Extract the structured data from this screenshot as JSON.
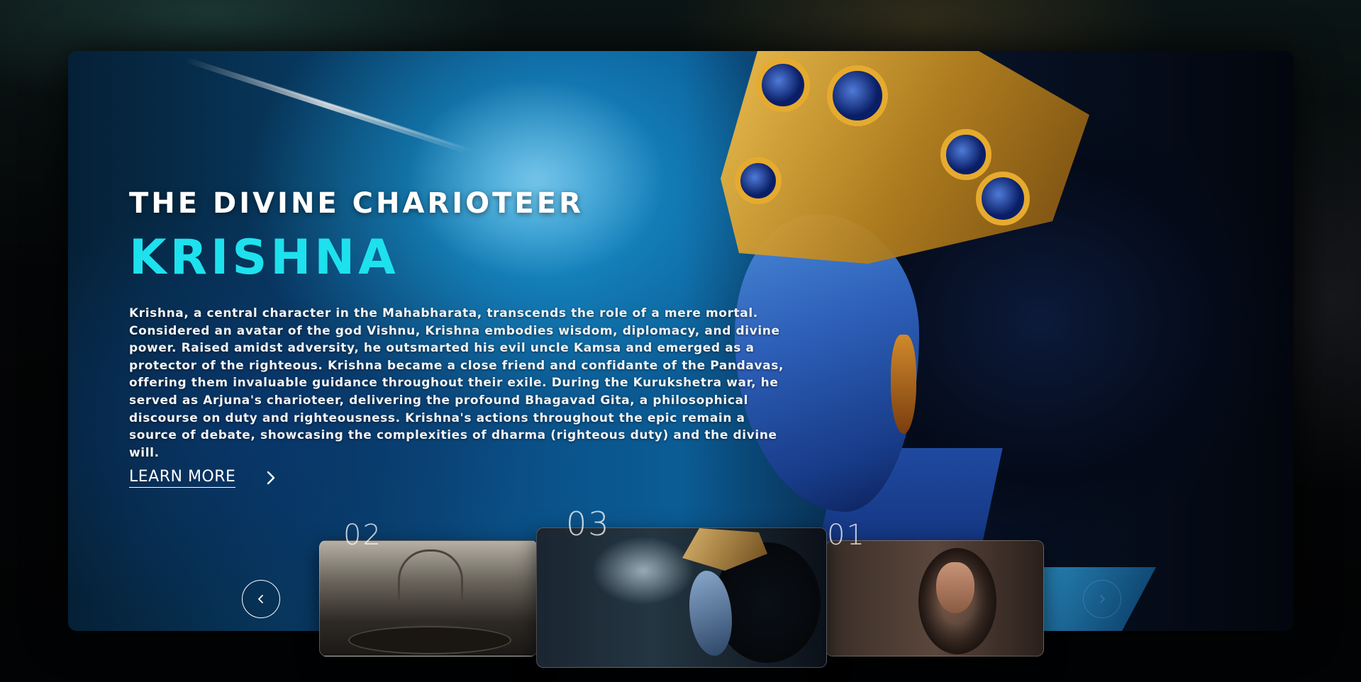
{
  "hero": {
    "subtitle": "THE DIVINE CHARIOTEER",
    "title": "KRISHNA",
    "description": "Krishna, a central character in the Mahabharata, transcends the role of a mere mortal. Considered an avatar of the god Vishnu, Krishna embodies wisdom, diplomacy, and divine power. Raised amidst adversity, he outsmarted his evil uncle Kamsa and emerged as a protector of the righteous. Krishna became a close friend and confidante of the Pandavas, offering them invaluable guidance throughout their exile. During the Kurukshetra war, he served as Arjuna's charioteer, delivering the profound Bhagavad Gita, a philosophical discourse on duty and righteousness. Krishna's actions throughout the epic remain a source of debate, showcasing the complexities of dharma (righteous duty) and the divine will.",
    "cta_label": "LEARN MORE",
    "cta_icon": "chevron-right-icon"
  },
  "slider": {
    "prev_icon": "chevron-left-icon",
    "next_icon": "chevron-right-icon",
    "thumbnails": [
      {
        "number": "02",
        "active": false
      },
      {
        "number": "03",
        "active": true
      },
      {
        "number": "01",
        "active": false
      }
    ]
  },
  "colors": {
    "accent": "#1ee1ee",
    "text": "#ffffff"
  }
}
